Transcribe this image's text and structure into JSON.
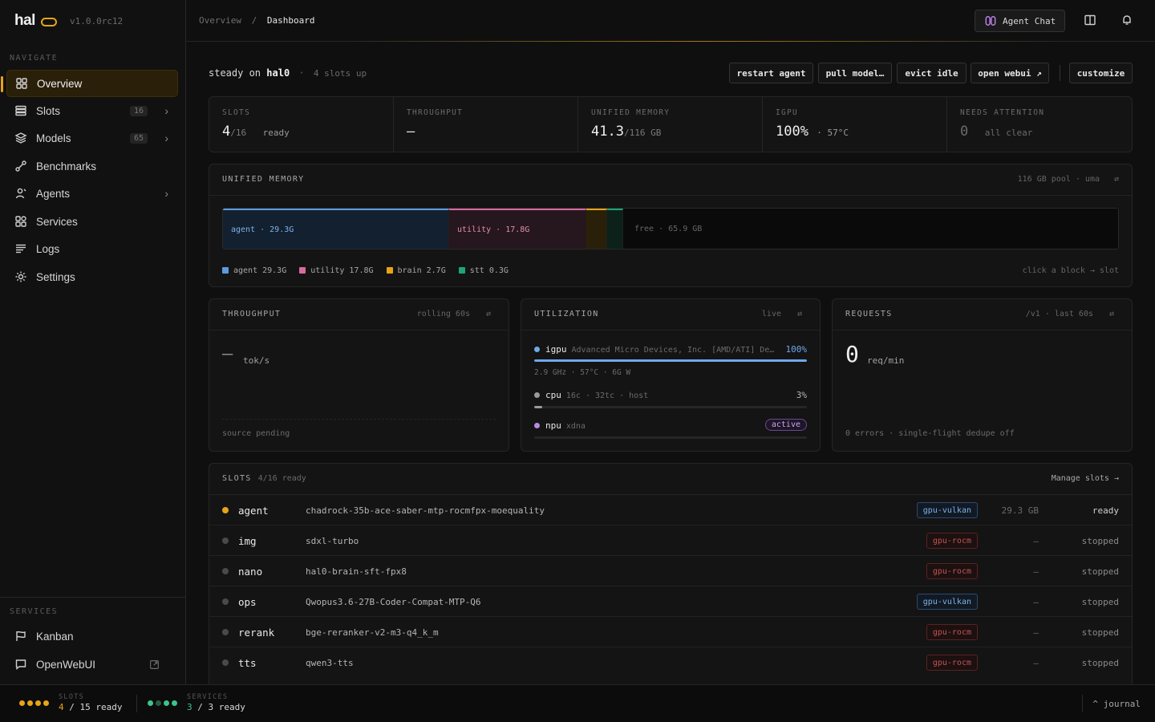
{
  "app": {
    "name": "hal",
    "version": "v1.0.0rc12"
  },
  "sidebar": {
    "nav_header": "NAVIGATE",
    "items": [
      {
        "label": "Overview",
        "icon": "overview-icon",
        "active": true
      },
      {
        "label": "Slots",
        "icon": "slots-icon",
        "count": "16"
      },
      {
        "label": "Models",
        "icon": "models-icon",
        "count": "65"
      },
      {
        "label": "Benchmarks",
        "icon": "benchmarks-icon"
      },
      {
        "label": "Agents",
        "icon": "agents-icon"
      },
      {
        "label": "Services",
        "icon": "services-icon"
      },
      {
        "label": "Logs",
        "icon": "logs-icon"
      },
      {
        "label": "Settings",
        "icon": "settings-icon"
      }
    ],
    "services_header": "SERVICES",
    "services": [
      {
        "label": "Kanban",
        "icon": "kanban-icon"
      },
      {
        "label": "OpenWebUI",
        "icon": "chat-bubble-icon"
      }
    ]
  },
  "topbar": {
    "breadcrumb": [
      "Overview",
      "Dashboard"
    ],
    "breadcrumb_sep": "/",
    "agent_chat": "Agent Chat"
  },
  "status": {
    "prefix": "steady on",
    "host": "hal0",
    "sep": "·",
    "sub": "4 slots up"
  },
  "actions": [
    "restart agent",
    "pull model…",
    "evict idle",
    "open webui ↗",
    "customize"
  ],
  "stats": [
    {
      "label": "SLOTS",
      "value": "4",
      "unit": "/16",
      "note": "ready"
    },
    {
      "label": "THROUGHPUT",
      "value": "—",
      "unit": "",
      "note": ""
    },
    {
      "label": "UNIFIED MEMORY",
      "value": "41.3",
      "unit": "/116 GB",
      "note": ""
    },
    {
      "label": "IGPU",
      "value": "100%",
      "unit": "",
      "note": "· 57°C"
    },
    {
      "label": "NEEDS ATTENTION",
      "value": "0",
      "unit": "",
      "note": "all clear"
    }
  ],
  "memory": {
    "title": "UNIFIED MEMORY",
    "right": "116 GB pool · uma",
    "total_gb": 116,
    "segments": [
      {
        "name": "agent",
        "label": "agent · 29.3G",
        "gb": 29.3,
        "color": "#5b9be0"
      },
      {
        "name": "utility",
        "label": "utility · 17.8G",
        "gb": 17.8,
        "color": "#d96aa0"
      },
      {
        "name": "brain",
        "label": "",
        "gb": 2.7,
        "color": "#e6a419"
      },
      {
        "name": "stt",
        "label": "",
        "gb": 0.3,
        "color": "#1fa37a"
      }
    ],
    "free_label": "free · 65.9 GB",
    "legend": [
      "agent 29.3G",
      "utility 17.8G",
      "brain 2.7G",
      "stt 0.3G"
    ],
    "hint": "click a block → slot"
  },
  "throughput": {
    "title": "THROUGHPUT",
    "right": "rolling 60s",
    "value": "—",
    "unit": "tok/s",
    "footer": "source pending"
  },
  "utilization": {
    "title": "UTILIZATION",
    "right": "live",
    "igpu": {
      "name": "igpu",
      "info": "Advanced Micro Devices, Inc. [AMD/ATI] De…",
      "pct": "100%",
      "level": 100,
      "sub": "2.9 GHz · 57°C · 6G W"
    },
    "cpu": {
      "name": "cpu",
      "info": "16c · 32tc · host",
      "pct": "3%",
      "level": 3
    },
    "npu": {
      "name": "npu",
      "info": "xdna",
      "badge": "active",
      "level": 0
    }
  },
  "requests": {
    "title": "REQUESTS",
    "right": "/v1 · last 60s",
    "value": "0",
    "unit": "req/min",
    "footer": "0 errors · single-flight dedupe off"
  },
  "slots": {
    "title": "SLOTS",
    "summary": "4/16 ready",
    "manage": "Manage slots →",
    "rows": [
      {
        "name": "agent",
        "model": "chadrock-35b-ace-saber-mtp-rocmfpx-moequality",
        "backend": "gpu-vulkan",
        "mem": "29.3 GB",
        "status": "ready"
      },
      {
        "name": "img",
        "model": "sdxl-turbo",
        "backend": "gpu-rocm",
        "mem": "—",
        "status": "stopped"
      },
      {
        "name": "nano",
        "model": "hal0-brain-sft-fpx8",
        "backend": "gpu-rocm",
        "mem": "—",
        "status": "stopped"
      },
      {
        "name": "ops",
        "model": "Qwopus3.6-27B-Coder-Compat-MTP-Q6",
        "backend": "gpu-vulkan",
        "mem": "—",
        "status": "stopped"
      },
      {
        "name": "rerank",
        "model": "bge-reranker-v2-m3-q4_k_m",
        "backend": "gpu-rocm",
        "mem": "—",
        "status": "stopped"
      },
      {
        "name": "tts",
        "model": "qwen3-tts",
        "backend": "gpu-rocm",
        "mem": "—",
        "status": "stopped"
      }
    ]
  },
  "footer": {
    "slots_label": "SLOTS",
    "slots_ready": "4",
    "slots_rest": "/ 15 ready",
    "services_label": "SERVICES",
    "services_ready": "3",
    "services_rest": "/ 3 ready",
    "journal": "^ journal"
  },
  "colors": {
    "accent": "#e6a419",
    "ready_dot": "#e6a419",
    "idle_dot": "#4a4a4a"
  }
}
